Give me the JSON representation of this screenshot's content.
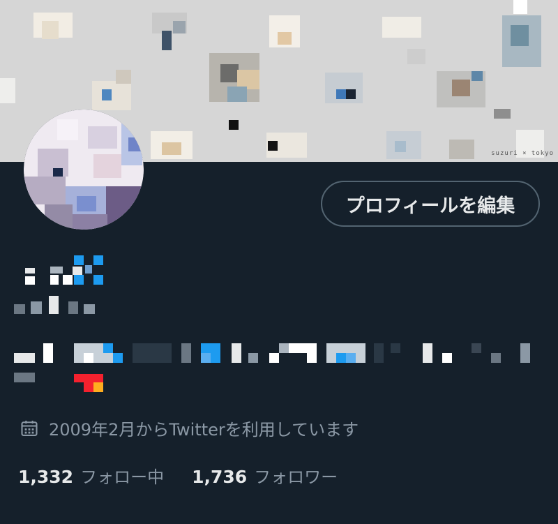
{
  "profile": {
    "edit_button_label": "プロフィールを編集",
    "banner_caption": "suzuri × tokyo",
    "joined_text": "2009年2月からTwitterを利用しています",
    "following_count": "1,332",
    "following_label": "フォロー中",
    "followers_count": "1,736",
    "followers_label": "フォロワー"
  },
  "icons": {
    "calendar": "calendar-icon"
  },
  "colors": {
    "background": "#15202b",
    "banner": "#d6d6d6",
    "secondary_text": "#8b98a5",
    "button_border": "#536471",
    "accent_blue": "#1d9bf0"
  }
}
